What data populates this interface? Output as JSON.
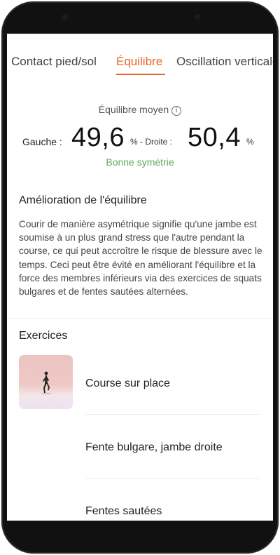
{
  "tabs": [
    {
      "label": "Contact pied/sol",
      "active": false
    },
    {
      "label": "Équilibre",
      "active": true
    },
    {
      "label": "Oscillation verticale",
      "active": false
    }
  ],
  "balance": {
    "title": "Équilibre moyen",
    "left_label": "Gauche :",
    "left_value": "49,6",
    "middle_label": "% - Droite :",
    "right_value": "50,4",
    "right_unit": "%",
    "status": "Bonne symétrie"
  },
  "improvement": {
    "title": "Amélioration de l'équilibre",
    "text": "Courir de manière asymétrique signifie qu'une jambe est soumise à un plus grand stress que l'autre pendant la course, ce qui peut accroître le risque de blessure avec le temps. Ceci peut être évité en améliorant l'équilibre et la force des membres inférieurs via des exercices de squats bulgares et de fentes sautées alternées."
  },
  "exercises": {
    "title": "Exercices",
    "items": [
      {
        "name": "Course sur place"
      },
      {
        "name": "Fente bulgare, jambe droite"
      },
      {
        "name": "Fentes sautées"
      }
    ]
  },
  "colors": {
    "accent": "#e4672a",
    "status_good": "#5ea85e",
    "frame": "#111111"
  }
}
